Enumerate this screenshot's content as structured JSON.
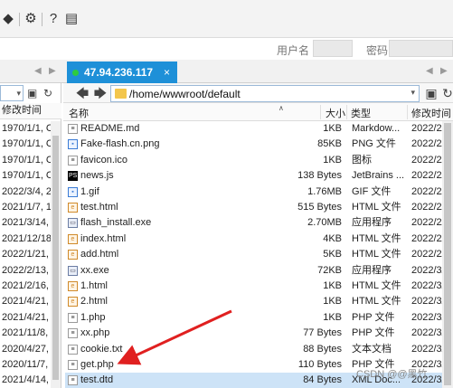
{
  "toolbar": {
    "username_label": "用户名",
    "password_label": "密码"
  },
  "tab": {
    "host": "47.94.236.117",
    "close": "×"
  },
  "address": {
    "path": "/home/wwwroot/default"
  },
  "left_pane": {
    "header": "修改时间",
    "rows": [
      "1970/1/1, C",
      "1970/1/1, C",
      "1970/1/1, C",
      "1970/1/1, C",
      "2022/3/4, 2",
      "2021/1/7, 1",
      "2021/3/14,",
      "2021/12/18",
      "2022/1/21,",
      "2022/2/13,",
      "2021/2/16,",
      "2021/4/21,",
      "2021/4/21,",
      "2021/11/8,",
      "2020/4/27,",
      "2020/11/7,",
      "2021/4/14,"
    ]
  },
  "list": {
    "columns": {
      "name": "名称",
      "size": "大小",
      "type": "类型",
      "modified": "修改时间"
    },
    "files": [
      {
        "name": "README.md",
        "size": "1KB",
        "type": "Markdow...",
        "date": "2022/2/",
        "icon": "document-icon"
      },
      {
        "name": "Fake-flash.cn.png",
        "size": "85KB",
        "type": "PNG 文件",
        "date": "2022/2/",
        "icon": "image-icon"
      },
      {
        "name": "favicon.ico",
        "size": "1KB",
        "type": "图标",
        "date": "2022/2/",
        "icon": "document-icon"
      },
      {
        "name": "news.js",
        "size": "138 Bytes",
        "type": "JetBrains ...",
        "date": "2022/2/",
        "icon": "phpstorm-icon"
      },
      {
        "name": "1.gif",
        "size": "1.76MB",
        "type": "GIF 文件",
        "date": "2022/2/",
        "icon": "image-icon"
      },
      {
        "name": "test.html",
        "size": "515 Bytes",
        "type": "HTML 文件",
        "date": "2022/2/",
        "icon": "html-icon"
      },
      {
        "name": "flash_install.exe",
        "size": "2.70MB",
        "type": "应用程序",
        "date": "2022/2/",
        "icon": "exe-icon"
      },
      {
        "name": "index.html",
        "size": "4KB",
        "type": "HTML 文件",
        "date": "2022/2/",
        "icon": "html-icon"
      },
      {
        "name": "add.html",
        "size": "5KB",
        "type": "HTML 文件",
        "date": "2022/2/",
        "icon": "html-icon"
      },
      {
        "name": "xx.exe",
        "size": "72KB",
        "type": "应用程序",
        "date": "2022/3/",
        "icon": "exe-icon"
      },
      {
        "name": "1.html",
        "size": "1KB",
        "type": "HTML 文件",
        "date": "2022/3/",
        "icon": "html-icon"
      },
      {
        "name": "2.html",
        "size": "1KB",
        "type": "HTML 文件",
        "date": "2022/3/",
        "icon": "html-icon"
      },
      {
        "name": "1.php",
        "size": "1KB",
        "type": "PHP 文件",
        "date": "2022/3/",
        "icon": "document-icon"
      },
      {
        "name": "xx.php",
        "size": "77 Bytes",
        "type": "PHP 文件",
        "date": "2022/3/",
        "icon": "document-icon"
      },
      {
        "name": "cookie.txt",
        "size": "88 Bytes",
        "type": "文本文档",
        "date": "2022/3/",
        "icon": "document-icon"
      },
      {
        "name": "get.php",
        "size": "110 Bytes",
        "type": "PHP 文件",
        "date": "2022/3/",
        "icon": "document-icon"
      },
      {
        "name": "test.dtd",
        "size": "84 Bytes",
        "type": "XML Doc...",
        "date": "2022/3/",
        "icon": "document-icon"
      }
    ]
  },
  "watermark": "CSDN @@黑竹",
  "colors": {
    "tab_active": "#1e90d8",
    "selected_row": "#cde3f7",
    "annotation_arrow": "#e02020"
  }
}
